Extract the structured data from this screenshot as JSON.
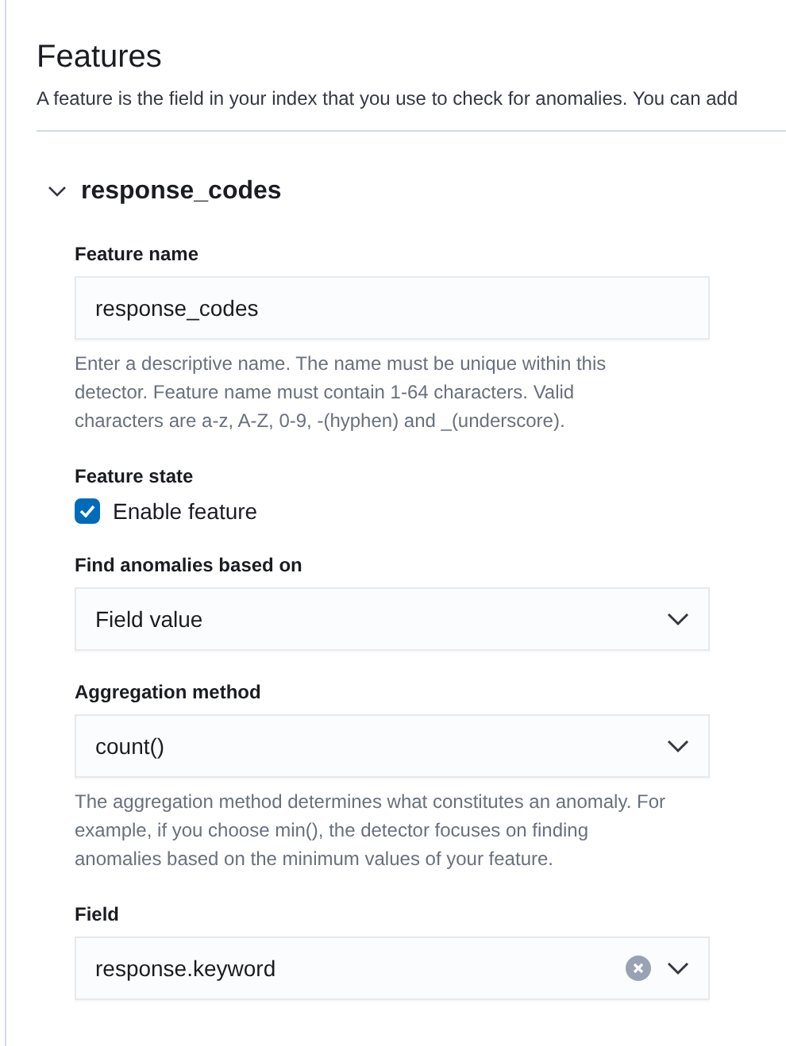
{
  "header": {
    "title": "Features",
    "description": "A feature is the field in your index that you use to check for anomalies. You can add"
  },
  "feature": {
    "name": "response_codes",
    "expanded": true,
    "fields": [
      {
        "kind": "text",
        "label": "Feature name",
        "value": "response_codes",
        "help": "Enter a descriptive name. The name must be unique within this detector. Feature name must contain 1-64 characters. Valid characters are a-z, A-Z, 0-9, -(hyphen) and _(underscore)."
      },
      {
        "kind": "checkbox",
        "label": "Feature state",
        "option": "Enable feature",
        "checked": true
      },
      {
        "kind": "select",
        "label": "Find anomalies based on",
        "value": "Field value"
      },
      {
        "kind": "select",
        "label": "Aggregation method",
        "value": "count()",
        "help": "The aggregation method determines what constitutes an anomaly. For example, if you choose min(), the detector focuses on finding anomalies based on the minimum values of your feature."
      },
      {
        "kind": "combo",
        "label": "Field",
        "value": "response.keyword",
        "clearable": true
      }
    ]
  }
}
